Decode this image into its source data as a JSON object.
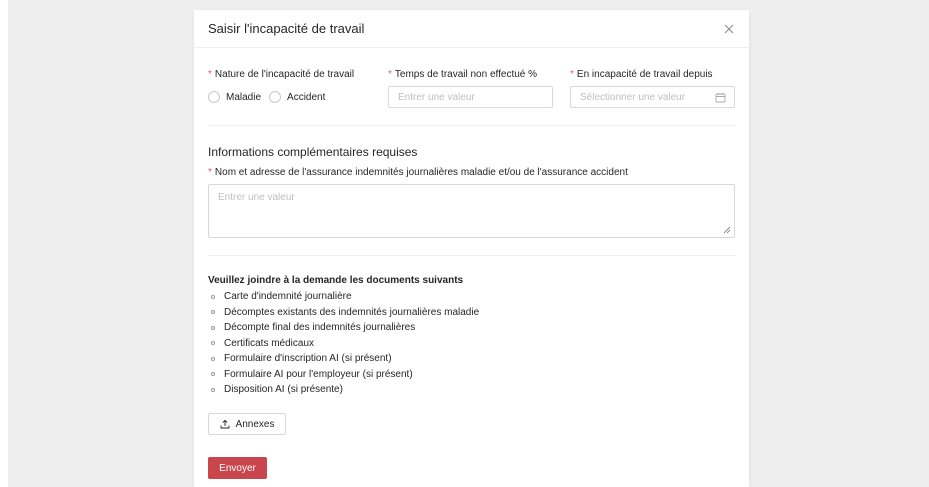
{
  "modal": {
    "title": "Saisir l'incapacité de travail"
  },
  "form": {
    "required_mark": "*",
    "nature": {
      "label": "Nature de l'incapacité de travail",
      "options": [
        "Maladie",
        "Accident"
      ]
    },
    "work_time": {
      "label": "Temps de travail non effectué %",
      "placeholder": "Entrer une valeur"
    },
    "since": {
      "label": "En incapacité de travail depuis",
      "placeholder": "Sélectionner une valeur"
    }
  },
  "additional": {
    "section_title": "Informations complémentaires requises",
    "insurance_label": "Nom et adresse de l'assurance indemnités journalières maladie et/ou de l'assurance accident",
    "insurance_placeholder": "Entrer une valeur"
  },
  "documents": {
    "title": "Veuillez joindre à la demande les documents suivants",
    "items": [
      "Carte d'indemnité journalière",
      "Décomptes existants des indemnités journalières maladie",
      "Décompte final des indemnités journalières",
      "Certificats médicaux",
      "Formulaire d'inscription AI (si présent)",
      "Formulaire AI pour l'employeur (si présent)",
      "Disposition AI (si présente)"
    ]
  },
  "actions": {
    "annexes_label": "Annexes",
    "submit_label": "Envoyer"
  },
  "icons": {
    "close": "close-icon",
    "calendar": "calendar-icon",
    "upload": "upload-icon"
  },
  "colors": {
    "accent": "#c9464d",
    "required": "#e25c5c",
    "backdrop": "#eeeeee"
  }
}
